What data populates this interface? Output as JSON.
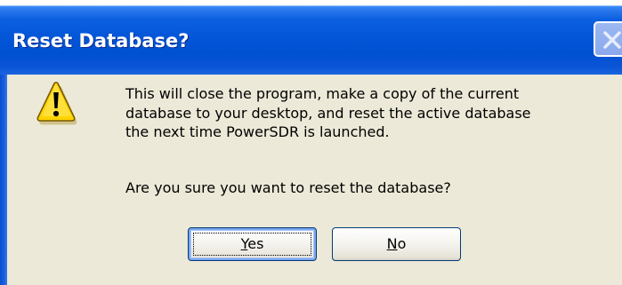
{
  "dialog": {
    "title": "Reset Database?",
    "icon": "warning-icon",
    "message_lines": [
      "This will close the program, make a copy of the current",
      "database to your desktop, and reset the active database",
      "the next time PowerSDR is launched."
    ],
    "question": "Are you sure you want to reset the database?",
    "buttons": {
      "yes": {
        "mnemonic": "Y",
        "rest": "es"
      },
      "no": {
        "mnemonic": "N",
        "rest": "o"
      }
    },
    "close_icon": "close-icon"
  },
  "colors": {
    "titlebar": "#0054e3",
    "client_background": "#ece9d8",
    "warning_yellow": "#ffd200",
    "button_border": "#003c74"
  }
}
